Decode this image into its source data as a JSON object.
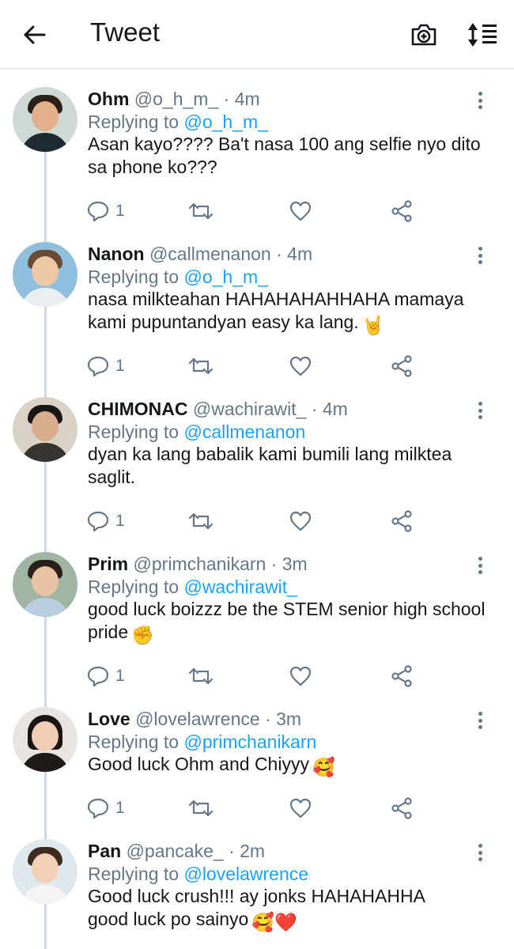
{
  "header": {
    "title": "Tweet",
    "back_icon": "arrow-left-icon",
    "camera_icon": "camera-plus-icon",
    "sort_icon": "sort-list-icon"
  },
  "colors": {
    "link": "#1da1f2",
    "secondary": "#657786",
    "primary_text": "#14171a",
    "divider": "#e6ecf0"
  },
  "replies": [
    {
      "name": "Ohm",
      "handle": "@o_h_m_",
      "time": "· 4m",
      "replying_prefix": "Replying to",
      "replying_to": "@o_h_m_",
      "text": "Asan kayo???? Ba't nasa 100 ang selfie nyo dito sa phone ko???",
      "emoji": "",
      "reply_count": "1"
    },
    {
      "name": "Nanon",
      "handle": "@callmenanon",
      "time": "· 4m",
      "replying_prefix": "Replying to",
      "replying_to": "@o_h_m_",
      "text": "nasa milkteahan HAHAHAHAHHAHA mamaya kami pupuntandyan easy ka lang.",
      "emoji": "🤘",
      "reply_count": "1"
    },
    {
      "name": "CHIMONAC",
      "handle": "@wachirawit_",
      "time": "· 4m",
      "replying_prefix": "Replying to",
      "replying_to": "@callmenanon",
      "text": "dyan ka lang babalik kami bumili lang milktea saglit.",
      "emoji": "",
      "reply_count": "1"
    },
    {
      "name": "Prim",
      "handle": "@primchanikarn",
      "time": "· 3m",
      "replying_prefix": "Replying to",
      "replying_to": "@wachirawit_",
      "text": "good luck boizzz be the STEM senior high school pride",
      "emoji": "✊",
      "reply_count": "1"
    },
    {
      "name": "Love",
      "handle": "@lovelawrence",
      "time": "· 3m",
      "replying_prefix": "Replying to",
      "replying_to": "@primchanikarn",
      "text": "Good luck Ohm and Chiyyy",
      "emoji": "🥰",
      "reply_count": "1"
    },
    {
      "name": "Pan",
      "handle": "@pancake_",
      "time": "· 2m",
      "replying_prefix": "Replying to",
      "replying_to": "@lovelawrence",
      "text": "Good luck crush!!! ay jonks HAHAHAHHA good luck po sainyo",
      "emoji": "🥰❤️",
      "reply_count": ""
    }
  ],
  "action_icons": [
    "reply-icon",
    "retweet-icon",
    "like-icon",
    "share-icon"
  ]
}
